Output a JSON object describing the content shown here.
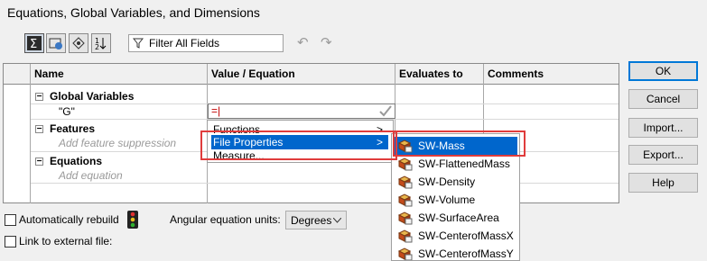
{
  "window": {
    "title": "Equations, Global Variables, and Dimensions"
  },
  "toolbar": {
    "buttons": [
      {
        "icon": "sigma-equation-view-icon"
      },
      {
        "icon": "sketch-equation-view-icon"
      },
      {
        "icon": "dimension-view-icon"
      },
      {
        "icon": "ordered-view-icon"
      }
    ],
    "filter_label": "Filter All Fields",
    "undo_icon": "undo-icon",
    "redo_icon": "redo-icon"
  },
  "table": {
    "headers": {
      "name": "Name",
      "value": "Value / Equation",
      "evaluates": "Evaluates to",
      "comments": "Comments"
    },
    "global_variables": {
      "label": "Global Variables",
      "expander": "−",
      "var_name": "\"G\"",
      "value": "=|"
    },
    "features": {
      "label": "Features",
      "expander": "−",
      "hint": "Add feature suppression"
    },
    "equations": {
      "label": "Equations",
      "expander": "−",
      "hint": "Add equation"
    }
  },
  "context_menu": {
    "items": [
      {
        "label": "Functions",
        "arrow": ">"
      },
      {
        "label": "File Properties",
        "arrow": ">"
      },
      {
        "label": "Measure..."
      }
    ]
  },
  "file_properties_menu": {
    "items": [
      "SW-Mass",
      "SW-FlattenedMass",
      "SW-Density",
      "SW-Volume",
      "SW-SurfaceArea",
      "SW-CenterofMassX",
      "SW-CenterofMassY"
    ],
    "selected": "SW-Mass"
  },
  "side_buttons": {
    "ok": "OK",
    "cancel": "Cancel",
    "import": "Import...",
    "export": "Export...",
    "help": "Help"
  },
  "bottom": {
    "auto_rebuild_label": "Automatically rebuild",
    "angular_units_label": "Angular equation units:",
    "angular_units_value": "Degrees",
    "link_external_label": "Link to external file:"
  },
  "colors": {
    "highlight": "#0066cc",
    "callout": "#e03c3c"
  }
}
